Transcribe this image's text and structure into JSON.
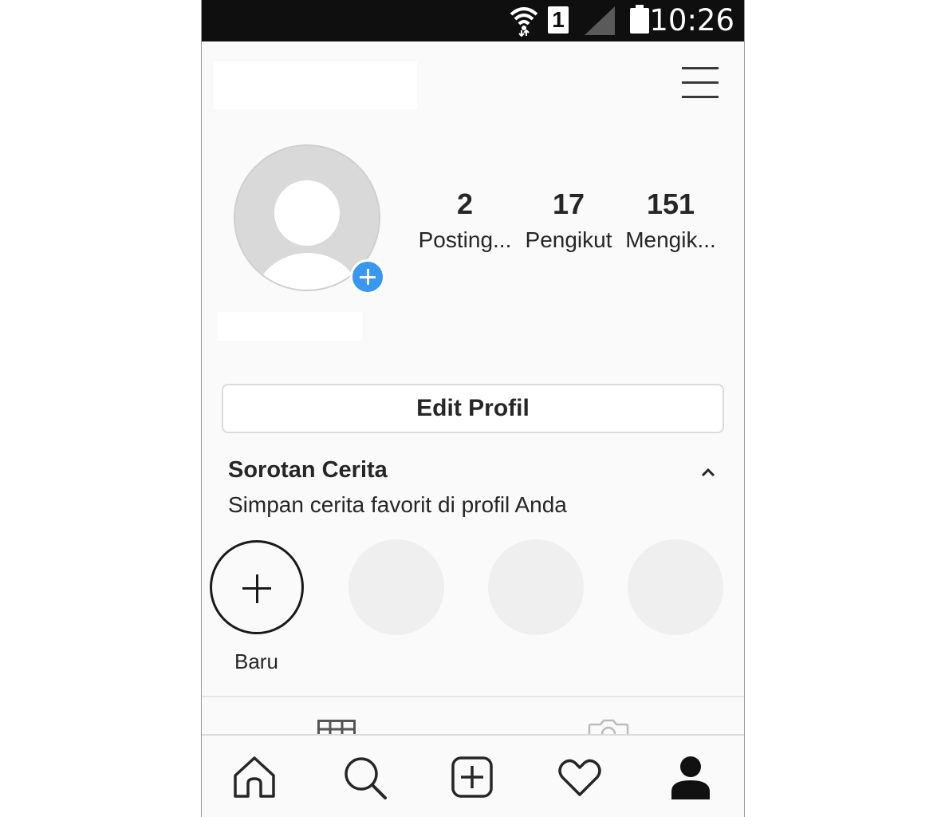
{
  "status_bar": {
    "time": "10:26",
    "sim_slot": "1"
  },
  "header": {
    "menu_icon": "hamburger-menu-icon"
  },
  "profile": {
    "stats": [
      {
        "value": "2",
        "label": "Posting..."
      },
      {
        "value": "17",
        "label": "Pengikut"
      },
      {
        "value": "151",
        "label": "Mengik..."
      }
    ],
    "edit_button_label": "Edit Profil"
  },
  "highlights": {
    "title": "Sorotan Cerita",
    "subtitle": "Simpan cerita favorit di profil Anda",
    "new_label": "Baru"
  },
  "tabs": [
    "grid-icon",
    "tagged-photos-icon"
  ],
  "bottom_nav": [
    "home-icon",
    "search-icon",
    "add-post-icon",
    "activity-heart-icon",
    "profile-icon"
  ],
  "colors": {
    "accent_blue": "#3897f0",
    "status_bar": "#0f0f0f",
    "background": "#fafafa",
    "text": "#262626"
  }
}
